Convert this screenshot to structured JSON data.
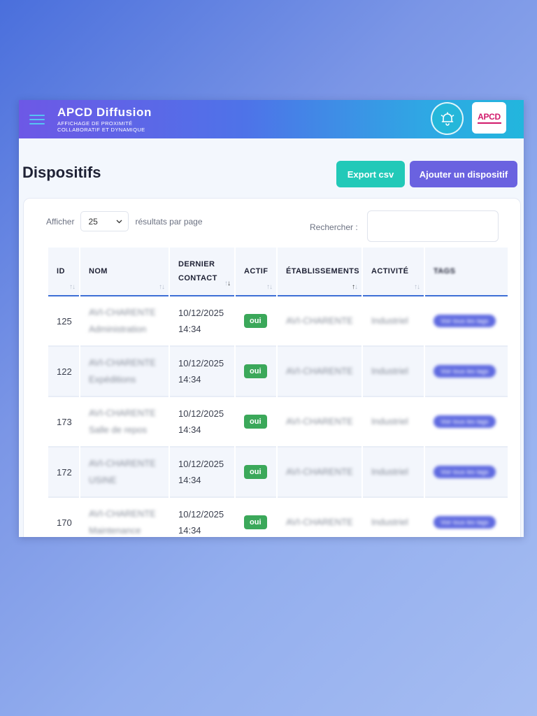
{
  "app": {
    "title": "APCD Diffusion",
    "subtitle": "AFFICHAGE DE PROXIMITÉ COLLABORATIF ET DYNAMIQUE",
    "logo_text_main": "APCD",
    "logo_text_sub": "DIFFUSION"
  },
  "page": {
    "title": "Dispositifs",
    "export_label": "Export csv",
    "add_label": "Ajouter un dispositif"
  },
  "controls": {
    "show_label": "Afficher",
    "page_size": "25",
    "per_page_label": "résultats par page",
    "search_label": "Rechercher :",
    "search_value": ""
  },
  "table": {
    "headers": {
      "id": "ID",
      "nom": "NOM",
      "contact_line1": "DERNIER",
      "contact_line2": "CONTACT",
      "actif": "ACTIF",
      "etablissements": "ÉTABLISSEMENTS",
      "activite": "ACTIVITÉ",
      "tags": "TAGS"
    },
    "rows": [
      {
        "id": "125",
        "nom_1": "AVI-CHARENTE",
        "nom_2": "Administration",
        "date": "10/12/2025",
        "time": "14:34",
        "actif": "oui",
        "etab": "AVI-CHARENTE",
        "activite": "Industriel",
        "tags": "Voir tous les tags"
      },
      {
        "id": "122",
        "nom_1": "AVI-CHARENTE",
        "nom_2": "Expéditions",
        "date": "10/12/2025",
        "time": "14:34",
        "actif": "oui",
        "etab": "AVI-CHARENTE",
        "activite": "Industriel",
        "tags": "Voir tous les tags"
      },
      {
        "id": "173",
        "nom_1": "AVI-CHARENTE",
        "nom_2": "Salle de repos",
        "date": "10/12/2025",
        "time": "14:34",
        "actif": "oui",
        "etab": "AVI-CHARENTE",
        "activite": "Industriel",
        "tags": "Voir tous les tags"
      },
      {
        "id": "172",
        "nom_1": "AVI-CHARENTE",
        "nom_2": "USINE",
        "date": "10/12/2025",
        "time": "14:34",
        "actif": "oui",
        "etab": "AVI-CHARENTE",
        "activite": "Industriel",
        "tags": "Voir tous les tags"
      },
      {
        "id": "170",
        "nom_1": "AVI-CHARENTE",
        "nom_2": "Maintenance",
        "date": "10/12/2025",
        "time": "14:34",
        "actif": "oui",
        "etab": "AVI-CHARENTE",
        "activite": "Industriel",
        "tags": "Voir tous les tags"
      }
    ]
  },
  "icons": {
    "menu": "hamburger-icon",
    "bell": "alarm-bell-icon",
    "select": "chevron-down-icon",
    "sort": "sort-arrows-icon"
  },
  "colors": {
    "accent_purple": "#6a62e0",
    "accent_teal": "#22c9b8",
    "active_green": "#3ba85a",
    "header_gradient_start": "#6d58e6",
    "header_gradient_end": "#22b6dd"
  }
}
